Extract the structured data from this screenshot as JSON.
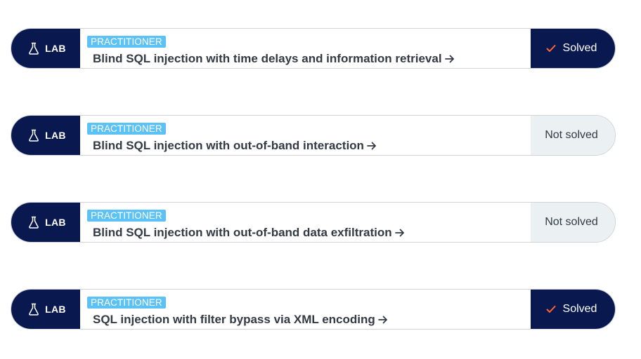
{
  "colors": {
    "lab_tag_bg": "#0a1850",
    "badge_bg": "#5cc2f5",
    "solved_bg": "#0a1850",
    "not_solved_bg": "#ebf0f2",
    "check_color": "#ff6633"
  },
  "labs": [
    {
      "tag": "LAB",
      "tag_icon": "flask-icon",
      "level": "PRACTITIONER",
      "title": "Blind SQL injection with time delays and information retrieval",
      "title_icon": "arrow-right-icon",
      "status": "Solved",
      "status_icon": "check-icon"
    },
    {
      "tag": "LAB",
      "tag_icon": "flask-icon",
      "level": "PRACTITIONER",
      "title": "Blind SQL injection with out-of-band interaction",
      "title_icon": "arrow-right-icon",
      "status": "Not solved"
    },
    {
      "tag": "LAB",
      "tag_icon": "flask-icon",
      "level": "PRACTITIONER",
      "title": "Blind SQL injection with out-of-band data exfiltration",
      "title_icon": "arrow-right-icon",
      "status": "Not solved"
    },
    {
      "tag": "LAB",
      "tag_icon": "flask-icon",
      "level": "PRACTITIONER",
      "title": "SQL injection with filter bypass via XML encoding",
      "title_icon": "arrow-right-icon",
      "status": "Solved",
      "status_icon": "check-icon"
    }
  ]
}
